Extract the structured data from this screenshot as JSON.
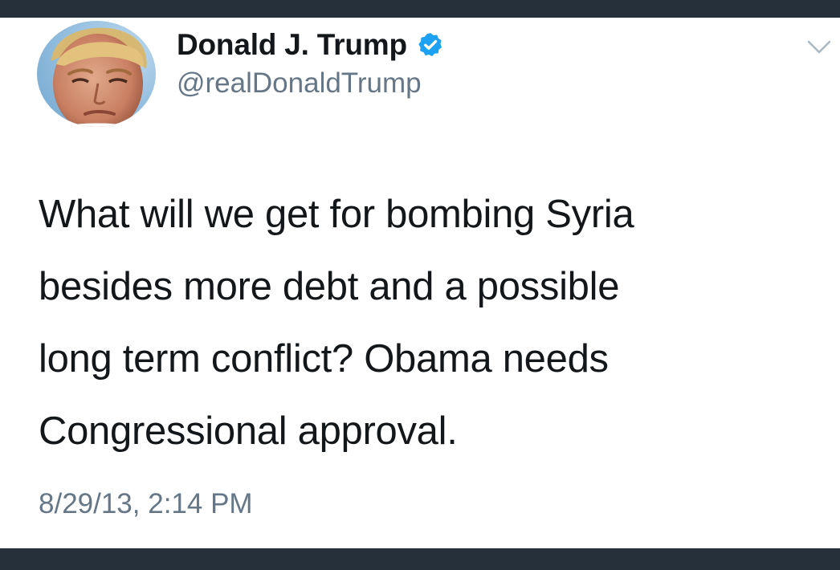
{
  "tweet": {
    "author": {
      "display_name": "Donald J. Trump",
      "handle": "@realDonaldTrump",
      "verified": true,
      "avatar_icon": "profile-photo-avatar"
    },
    "text_lines": [
      "What will we get for bombing Syria",
      "besides more debt and a possible",
      "long term conflict? Obama needs",
      "Congressional approval."
    ],
    "timestamp": "8/29/13, 2:14 PM",
    "menu_icon": "chevron-down-icon"
  },
  "colors": {
    "text_primary": "#14171a",
    "text_secondary": "#657786",
    "verified_blue": "#1da1f2",
    "frame_dark": "#26303b",
    "card_background": "#ffffff"
  }
}
